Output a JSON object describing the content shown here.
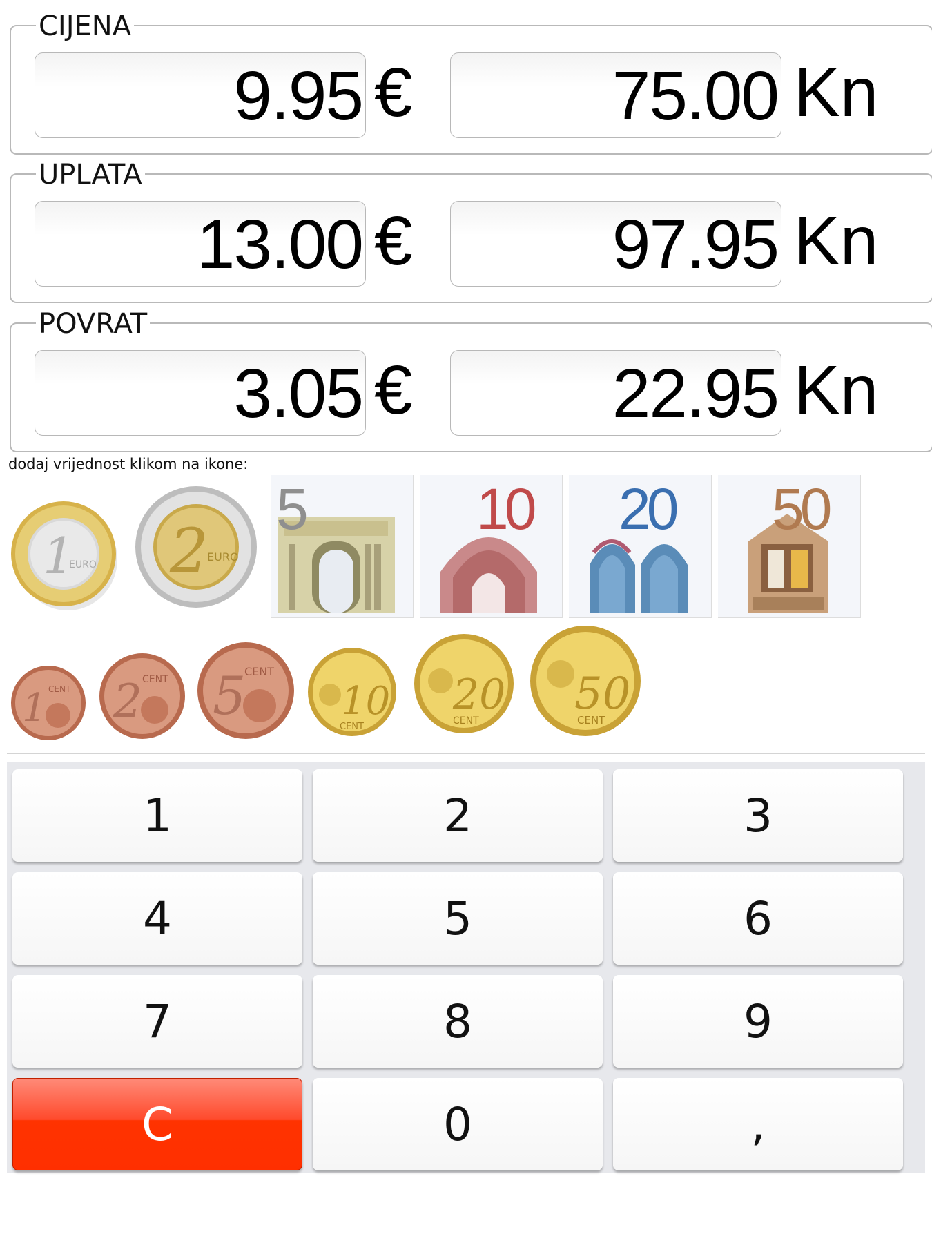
{
  "currency_units": {
    "eur": "€",
    "kn": "Kn"
  },
  "groups": [
    {
      "label": "CIJENA",
      "eur_value": "9.95",
      "kn_value": "75.00"
    },
    {
      "label": "UPLATA",
      "eur_value": "13.00",
      "kn_value": "97.95"
    },
    {
      "label": "POVRAT",
      "eur_value": "3.05",
      "kn_value": "22.95"
    }
  ],
  "hint_text": "dodaj vrijednost klikom na ikone:",
  "coins_large": [
    {
      "value_label": "1",
      "text": "EURO",
      "icon": "euro-1-coin-icon"
    },
    {
      "value_label": "2",
      "text": "EURO",
      "icon": "euro-2-coin-icon"
    }
  ],
  "banknotes": [
    {
      "value_label": "5",
      "icon": "euro-5-banknote-icon",
      "color": "#8f8f8f"
    },
    {
      "value_label": "10",
      "icon": "euro-10-banknote-icon",
      "color": "#c04a4a"
    },
    {
      "value_label": "20",
      "icon": "euro-20-banknote-icon",
      "color": "#3a6fb0"
    },
    {
      "value_label": "50",
      "icon": "euro-50-banknote-icon",
      "color": "#b07a50"
    }
  ],
  "coins_small": [
    {
      "value_label": "1",
      "text": "CENT",
      "icon": "cent-1-coin-icon"
    },
    {
      "value_label": "2",
      "text": "CENT",
      "icon": "cent-2-coin-icon"
    },
    {
      "value_label": "5",
      "text": "CENT",
      "icon": "cent-5-coin-icon"
    },
    {
      "value_label": "10",
      "text": "CENT",
      "icon": "cent-10-coin-icon"
    },
    {
      "value_label": "20",
      "text": "CENT",
      "icon": "cent-20-coin-icon"
    },
    {
      "value_label": "50",
      "text": "CENT",
      "icon": "cent-50-coin-icon"
    }
  ],
  "keypad": {
    "keys": [
      "1",
      "2",
      "3",
      "4",
      "5",
      "6",
      "7",
      "8",
      "9",
      "C",
      "0",
      ","
    ],
    "clear_color": "#ff3300"
  }
}
